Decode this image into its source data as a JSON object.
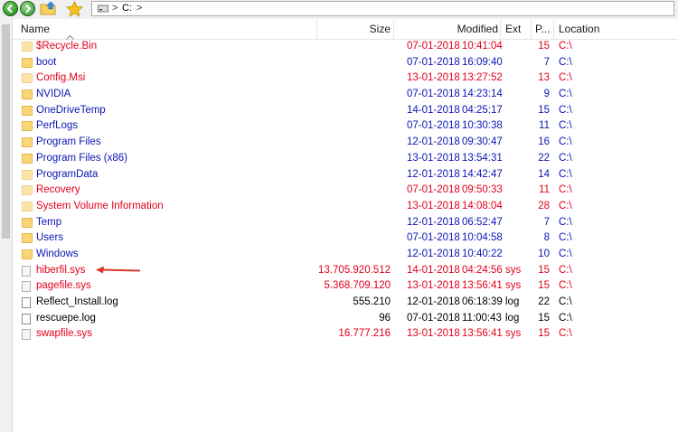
{
  "address": {
    "crumb": "C:",
    "separator": ">"
  },
  "columns": {
    "name": "Name",
    "size": "Size",
    "modified": "Modified",
    "ext": "Ext",
    "p": "P...",
    "location": "Location"
  },
  "colors": {
    "red": "#e0001a",
    "blue": "#0a14b4",
    "black": "#000000"
  },
  "rows": [
    {
      "name": "$Recycle.Bin",
      "size": "",
      "date": "07-01-2018",
      "time": "10:41:04",
      "ext": "",
      "p": "15",
      "loc": "C:\\",
      "type": "folder",
      "dim": true,
      "color": "red"
    },
    {
      "name": "boot",
      "size": "",
      "date": "07-01-2018",
      "time": "16:09:40",
      "ext": "",
      "p": "7",
      "loc": "C:\\",
      "type": "folder",
      "dim": false,
      "color": "blue"
    },
    {
      "name": "Config.Msi",
      "size": "",
      "date": "13-01-2018",
      "time": "13:27:52",
      "ext": "",
      "p": "13",
      "loc": "C:\\",
      "type": "folder",
      "dim": true,
      "color": "red"
    },
    {
      "name": "NVIDIA",
      "size": "",
      "date": "07-01-2018",
      "time": "14:23:14",
      "ext": "",
      "p": "9",
      "loc": "C:\\",
      "type": "folder",
      "dim": false,
      "color": "blue"
    },
    {
      "name": "OneDriveTemp",
      "size": "",
      "date": "14-01-2018",
      "time": "04:25:17",
      "ext": "",
      "p": "15",
      "loc": "C:\\",
      "type": "folder",
      "dim": false,
      "color": "blue"
    },
    {
      "name": "PerfLogs",
      "size": "",
      "date": "07-01-2018",
      "time": "10:30:38",
      "ext": "",
      "p": "11",
      "loc": "C:\\",
      "type": "folder",
      "dim": false,
      "color": "blue"
    },
    {
      "name": "Program Files",
      "size": "",
      "date": "12-01-2018",
      "time": "09:30:47",
      "ext": "",
      "p": "16",
      "loc": "C:\\",
      "type": "folder",
      "dim": false,
      "color": "blue"
    },
    {
      "name": "Program Files (x86)",
      "size": "",
      "date": "13-01-2018",
      "time": "13:54:31",
      "ext": "",
      "p": "22",
      "loc": "C:\\",
      "type": "folder",
      "dim": false,
      "color": "blue"
    },
    {
      "name": "ProgramData",
      "size": "",
      "date": "12-01-2018",
      "time": "14:42:47",
      "ext": "",
      "p": "14",
      "loc": "C:\\",
      "type": "folder",
      "dim": true,
      "color": "blue"
    },
    {
      "name": "Recovery",
      "size": "",
      "date": "07-01-2018",
      "time": "09:50:33",
      "ext": "",
      "p": "11",
      "loc": "C:\\",
      "type": "folder",
      "dim": true,
      "color": "red"
    },
    {
      "name": "System Volume Information",
      "size": "",
      "date": "13-01-2018",
      "time": "14:08:04",
      "ext": "",
      "p": "28",
      "loc": "C:\\",
      "type": "folder",
      "dim": true,
      "color": "red"
    },
    {
      "name": "Temp",
      "size": "",
      "date": "12-01-2018",
      "time": "06:52:47",
      "ext": "",
      "p": "7",
      "loc": "C:\\",
      "type": "folder",
      "dim": false,
      "color": "blue"
    },
    {
      "name": "Users",
      "size": "",
      "date": "07-01-2018",
      "time": "10:04:58",
      "ext": "",
      "p": "8",
      "loc": "C:\\",
      "type": "folder",
      "dim": false,
      "color": "blue"
    },
    {
      "name": "Windows",
      "size": "",
      "date": "12-01-2018",
      "time": "10:40:22",
      "ext": "",
      "p": "10",
      "loc": "C:\\",
      "type": "folder",
      "dim": false,
      "color": "blue"
    },
    {
      "name": "hiberfil.sys",
      "size": "13.705.920.512",
      "date": "14-01-2018",
      "time": "04:24:56",
      "ext": "sys",
      "p": "15",
      "loc": "C:\\",
      "type": "sysfile",
      "dim": false,
      "color": "red"
    },
    {
      "name": "pagefile.sys",
      "size": "5.368.709.120",
      "date": "13-01-2018",
      "time": "13:56:41",
      "ext": "sys",
      "p": "15",
      "loc": "C:\\",
      "type": "sysfile",
      "dim": false,
      "color": "red"
    },
    {
      "name": "Reflect_Install.log",
      "size": "555.210",
      "date": "12-01-2018",
      "time": "06:18:39",
      "ext": "log",
      "p": "22",
      "loc": "C:\\",
      "type": "file",
      "dim": false,
      "color": "black"
    },
    {
      "name": "rescuepe.log",
      "size": "96",
      "date": "07-01-2018",
      "time": "11:00:43",
      "ext": "log",
      "p": "15",
      "loc": "C:\\",
      "type": "file",
      "dim": false,
      "color": "black"
    },
    {
      "name": "swapfile.sys",
      "size": "16.777.216",
      "date": "13-01-2018",
      "time": "13:56:41",
      "ext": "sys",
      "p": "15",
      "loc": "C:\\",
      "type": "sysfile",
      "dim": false,
      "color": "red"
    }
  ]
}
